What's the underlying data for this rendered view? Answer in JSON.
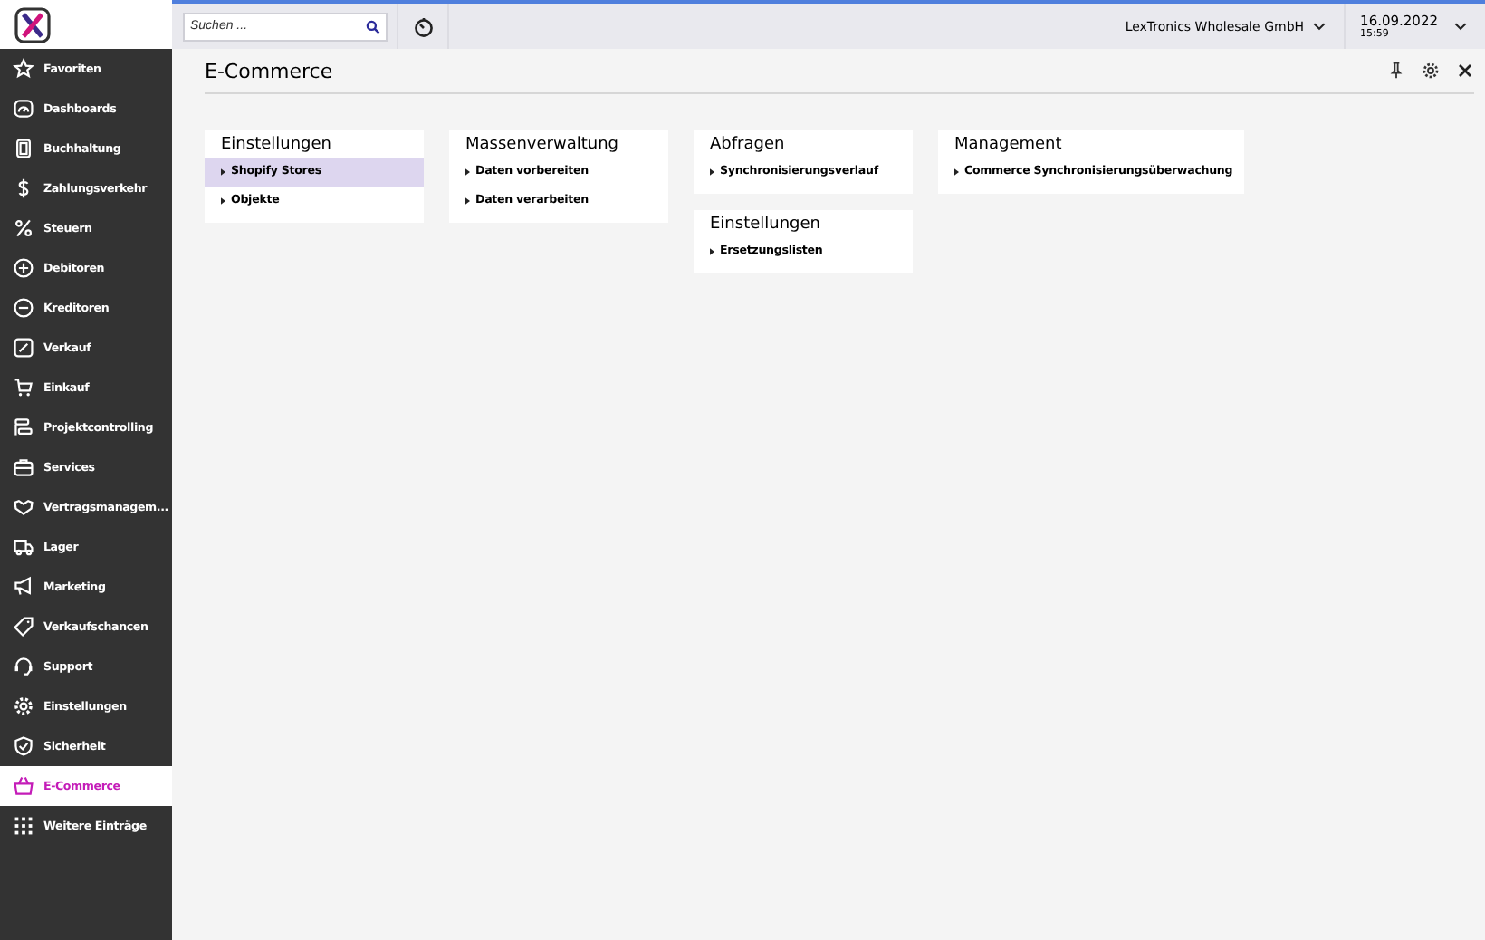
{
  "sidebar": {
    "items": [
      {
        "label": "Favoriten",
        "selected": false
      },
      {
        "label": "Dashboards",
        "selected": false
      },
      {
        "label": "Buchhaltung",
        "selected": false
      },
      {
        "label": "Zahlungsverkehr",
        "selected": false
      },
      {
        "label": "Steuern",
        "selected": false
      },
      {
        "label": "Debitoren",
        "selected": false
      },
      {
        "label": "Kreditoren",
        "selected": false
      },
      {
        "label": "Verkauf",
        "selected": false
      },
      {
        "label": "Einkauf",
        "selected": false
      },
      {
        "label": "Projektcontrolling",
        "selected": false
      },
      {
        "label": "Services",
        "selected": false
      },
      {
        "label": "Vertragsmanagem...",
        "selected": false
      },
      {
        "label": "Lager",
        "selected": false
      },
      {
        "label": "Marketing",
        "selected": false
      },
      {
        "label": "Verkaufschancen",
        "selected": false
      },
      {
        "label": "Support",
        "selected": false
      },
      {
        "label": "Einstellungen",
        "selected": false
      },
      {
        "label": "Sicherheit",
        "selected": false
      },
      {
        "label": "E-Commerce",
        "selected": true
      },
      {
        "label": "Weitere Einträge",
        "selected": false
      }
    ]
  },
  "topbar": {
    "search": {
      "placeholder": "Suchen ..."
    },
    "company": "LexTronics Wholesale GmbH",
    "date": "16.09.2022",
    "time": "15:59"
  },
  "page": {
    "title": "E-Commerce",
    "columns": [
      [
        {
          "title": "Einstellungen",
          "items": [
            {
              "label": "Shopify Stores",
              "selected": true
            },
            {
              "label": "Objekte",
              "selected": false
            }
          ]
        }
      ],
      [
        {
          "title": "Massenverwaltung",
          "items": [
            {
              "label": "Daten vorbereiten",
              "selected": false
            },
            {
              "label": "Daten verarbeiten",
              "selected": false
            }
          ]
        }
      ],
      [
        {
          "title": "Abfragen",
          "items": [
            {
              "label": "Synchronisierungsverlauf",
              "selected": false
            }
          ]
        },
        {
          "title": "Einstellungen",
          "items": [
            {
              "label": "Ersetzungslisten",
              "selected": false
            }
          ]
        }
      ],
      [
        {
          "title": "Management",
          "items": [
            {
              "label": "Commerce Synchronisierungsüberwachung",
              "selected": false
            }
          ]
        }
      ]
    ]
  }
}
